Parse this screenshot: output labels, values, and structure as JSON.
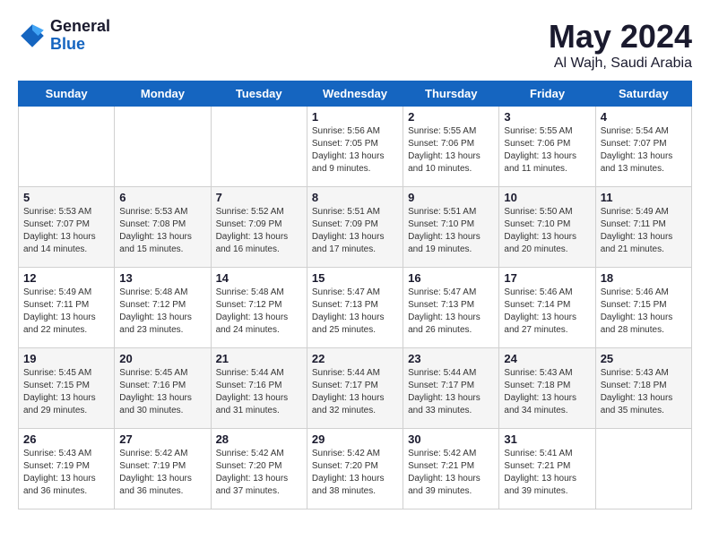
{
  "header": {
    "logo_general": "General",
    "logo_blue": "Blue",
    "month_title": "May 2024",
    "location": "Al Wajh, Saudi Arabia"
  },
  "days_of_week": [
    "Sunday",
    "Monday",
    "Tuesday",
    "Wednesday",
    "Thursday",
    "Friday",
    "Saturday"
  ],
  "weeks": [
    [
      {
        "day": "",
        "sunrise": "",
        "sunset": "",
        "daylight": ""
      },
      {
        "day": "",
        "sunrise": "",
        "sunset": "",
        "daylight": ""
      },
      {
        "day": "",
        "sunrise": "",
        "sunset": "",
        "daylight": ""
      },
      {
        "day": "1",
        "sunrise": "Sunrise: 5:56 AM",
        "sunset": "Sunset: 7:05 PM",
        "daylight": "Daylight: 13 hours and 9 minutes."
      },
      {
        "day": "2",
        "sunrise": "Sunrise: 5:55 AM",
        "sunset": "Sunset: 7:06 PM",
        "daylight": "Daylight: 13 hours and 10 minutes."
      },
      {
        "day": "3",
        "sunrise": "Sunrise: 5:55 AM",
        "sunset": "Sunset: 7:06 PM",
        "daylight": "Daylight: 13 hours and 11 minutes."
      },
      {
        "day": "4",
        "sunrise": "Sunrise: 5:54 AM",
        "sunset": "Sunset: 7:07 PM",
        "daylight": "Daylight: 13 hours and 13 minutes."
      }
    ],
    [
      {
        "day": "5",
        "sunrise": "Sunrise: 5:53 AM",
        "sunset": "Sunset: 7:07 PM",
        "daylight": "Daylight: 13 hours and 14 minutes."
      },
      {
        "day": "6",
        "sunrise": "Sunrise: 5:53 AM",
        "sunset": "Sunset: 7:08 PM",
        "daylight": "Daylight: 13 hours and 15 minutes."
      },
      {
        "day": "7",
        "sunrise": "Sunrise: 5:52 AM",
        "sunset": "Sunset: 7:09 PM",
        "daylight": "Daylight: 13 hours and 16 minutes."
      },
      {
        "day": "8",
        "sunrise": "Sunrise: 5:51 AM",
        "sunset": "Sunset: 7:09 PM",
        "daylight": "Daylight: 13 hours and 17 minutes."
      },
      {
        "day": "9",
        "sunrise": "Sunrise: 5:51 AM",
        "sunset": "Sunset: 7:10 PM",
        "daylight": "Daylight: 13 hours and 19 minutes."
      },
      {
        "day": "10",
        "sunrise": "Sunrise: 5:50 AM",
        "sunset": "Sunset: 7:10 PM",
        "daylight": "Daylight: 13 hours and 20 minutes."
      },
      {
        "day": "11",
        "sunrise": "Sunrise: 5:49 AM",
        "sunset": "Sunset: 7:11 PM",
        "daylight": "Daylight: 13 hours and 21 minutes."
      }
    ],
    [
      {
        "day": "12",
        "sunrise": "Sunrise: 5:49 AM",
        "sunset": "Sunset: 7:11 PM",
        "daylight": "Daylight: 13 hours and 22 minutes."
      },
      {
        "day": "13",
        "sunrise": "Sunrise: 5:48 AM",
        "sunset": "Sunset: 7:12 PM",
        "daylight": "Daylight: 13 hours and 23 minutes."
      },
      {
        "day": "14",
        "sunrise": "Sunrise: 5:48 AM",
        "sunset": "Sunset: 7:12 PM",
        "daylight": "Daylight: 13 hours and 24 minutes."
      },
      {
        "day": "15",
        "sunrise": "Sunrise: 5:47 AM",
        "sunset": "Sunset: 7:13 PM",
        "daylight": "Daylight: 13 hours and 25 minutes."
      },
      {
        "day": "16",
        "sunrise": "Sunrise: 5:47 AM",
        "sunset": "Sunset: 7:13 PM",
        "daylight": "Daylight: 13 hours and 26 minutes."
      },
      {
        "day": "17",
        "sunrise": "Sunrise: 5:46 AM",
        "sunset": "Sunset: 7:14 PM",
        "daylight": "Daylight: 13 hours and 27 minutes."
      },
      {
        "day": "18",
        "sunrise": "Sunrise: 5:46 AM",
        "sunset": "Sunset: 7:15 PM",
        "daylight": "Daylight: 13 hours and 28 minutes."
      }
    ],
    [
      {
        "day": "19",
        "sunrise": "Sunrise: 5:45 AM",
        "sunset": "Sunset: 7:15 PM",
        "daylight": "Daylight: 13 hours and 29 minutes."
      },
      {
        "day": "20",
        "sunrise": "Sunrise: 5:45 AM",
        "sunset": "Sunset: 7:16 PM",
        "daylight": "Daylight: 13 hours and 30 minutes."
      },
      {
        "day": "21",
        "sunrise": "Sunrise: 5:44 AM",
        "sunset": "Sunset: 7:16 PM",
        "daylight": "Daylight: 13 hours and 31 minutes."
      },
      {
        "day": "22",
        "sunrise": "Sunrise: 5:44 AM",
        "sunset": "Sunset: 7:17 PM",
        "daylight": "Daylight: 13 hours and 32 minutes."
      },
      {
        "day": "23",
        "sunrise": "Sunrise: 5:44 AM",
        "sunset": "Sunset: 7:17 PM",
        "daylight": "Daylight: 13 hours and 33 minutes."
      },
      {
        "day": "24",
        "sunrise": "Sunrise: 5:43 AM",
        "sunset": "Sunset: 7:18 PM",
        "daylight": "Daylight: 13 hours and 34 minutes."
      },
      {
        "day": "25",
        "sunrise": "Sunrise: 5:43 AM",
        "sunset": "Sunset: 7:18 PM",
        "daylight": "Daylight: 13 hours and 35 minutes."
      }
    ],
    [
      {
        "day": "26",
        "sunrise": "Sunrise: 5:43 AM",
        "sunset": "Sunset: 7:19 PM",
        "daylight": "Daylight: 13 hours and 36 minutes."
      },
      {
        "day": "27",
        "sunrise": "Sunrise: 5:42 AM",
        "sunset": "Sunset: 7:19 PM",
        "daylight": "Daylight: 13 hours and 36 minutes."
      },
      {
        "day": "28",
        "sunrise": "Sunrise: 5:42 AM",
        "sunset": "Sunset: 7:20 PM",
        "daylight": "Daylight: 13 hours and 37 minutes."
      },
      {
        "day": "29",
        "sunrise": "Sunrise: 5:42 AM",
        "sunset": "Sunset: 7:20 PM",
        "daylight": "Daylight: 13 hours and 38 minutes."
      },
      {
        "day": "30",
        "sunrise": "Sunrise: 5:42 AM",
        "sunset": "Sunset: 7:21 PM",
        "daylight": "Daylight: 13 hours and 39 minutes."
      },
      {
        "day": "31",
        "sunrise": "Sunrise: 5:41 AM",
        "sunset": "Sunset: 7:21 PM",
        "daylight": "Daylight: 13 hours and 39 minutes."
      },
      {
        "day": "",
        "sunrise": "",
        "sunset": "",
        "daylight": ""
      }
    ]
  ]
}
